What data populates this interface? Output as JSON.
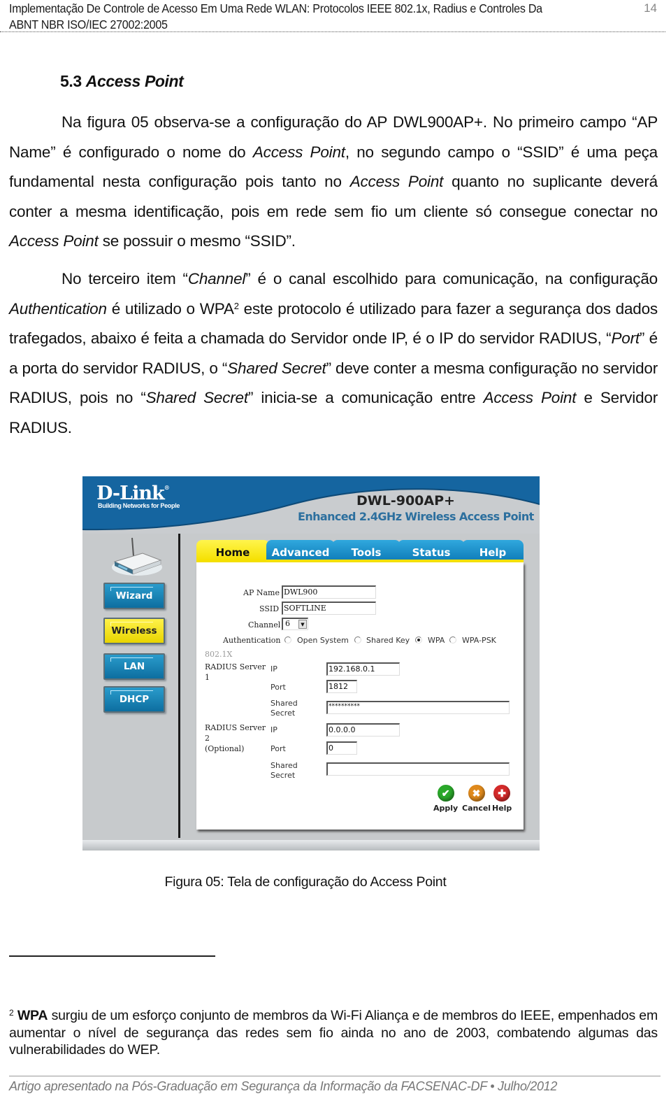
{
  "header": {
    "running_title_line1": "Implementação De Controle de Acesso Em Uma Rede WLAN: Protocolos IEEE 802.1x, Radius e Controles Da",
    "running_title_line2": "ABNT NBR ISO/IEC 27002:2005",
    "page_number": "14"
  },
  "section": {
    "number": "5.3",
    "title": "Access Point"
  },
  "paragraphs": {
    "p1": {
      "s1": "Na figura 05 observa-se a configuração do AP DWL900AP+. No primeiro campo “AP Name” é configurado o nome do ",
      "i1": "Access Point",
      "s2": ", no segundo campo o “SSID” é uma peça fundamental nesta configuração pois tanto no ",
      "i2": "Access Point",
      "s3": " quanto no suplicante deverá conter a mesma identificação, pois em rede sem fio um cliente só consegue conectar no ",
      "i3": "Access Point",
      "s4": " se possuir o mesmo “SSID”."
    },
    "p2": {
      "s1": "No terceiro item “",
      "i1": "Channel",
      "s2": "” é o canal escolhido para comunicação, na configuração ",
      "i2": "Authentication",
      "s3": " é utilizado o WPA",
      "sup": "2",
      "s4": " este protocolo é utilizado para fazer a segurança dos dados trafegados, abaixo é feita a chamada do Servidor onde IP, é o IP do servidor RADIUS, “",
      "i3": "Port",
      "s5": "” é a porta do servidor RADIUS, o “",
      "i4": "Shared Secret",
      "s6": "” deve conter a mesma configuração no servidor RADIUS, pois no “",
      "i5": "Shared Secret",
      "s7": "” inicia-se a comunicação entre ",
      "i6": "Access Point",
      "s8": " e Servidor RADIUS."
    }
  },
  "figure": {
    "brand": "D-Link",
    "brand_mark": "®",
    "tagline": "Building Networks for People",
    "model": "DWL-900AP+",
    "subtitle": "Enhanced 2.4GHz Wireless Access Point",
    "colors": {
      "brand_blue": "#1565a0",
      "tab_blue": "#1a8cc8",
      "tab_active_yellow": "#f5e000",
      "panel_gray": "#c7cacc"
    },
    "tabs": [
      {
        "label": "Home",
        "active": true
      },
      {
        "label": "Advanced",
        "active": false
      },
      {
        "label": "Tools",
        "active": false
      },
      {
        "label": "Status",
        "active": false
      },
      {
        "label": "Help",
        "active": false
      }
    ],
    "sidebar": [
      {
        "label": "Wizard",
        "active": false
      },
      {
        "label": "Wireless",
        "active": true
      },
      {
        "label": "LAN",
        "active": false
      },
      {
        "label": "DHCP",
        "active": false
      }
    ],
    "form": {
      "ap_name_label": "AP Name",
      "ap_name_value": "DWL900",
      "ssid_label": "SSID",
      "ssid_value": "SOFTLINE",
      "channel_label": "Channel",
      "channel_value": "6",
      "auth_label": "Authentication",
      "auth_options": [
        {
          "label": "Open System",
          "selected": false
        },
        {
          "label": "Shared Key",
          "selected": false
        },
        {
          "label": "WPA",
          "selected": true
        },
        {
          "label": "WPA-PSK",
          "selected": false
        }
      ],
      "section_8021x": "802.1X",
      "radius1": {
        "title_line1": "RADIUS Server",
        "title_line2": "1",
        "ip_label": "IP",
        "ip_value": "192.168.0.1",
        "port_label": "Port",
        "port_value": "1812",
        "secret_label_line1": "Shared",
        "secret_label_line2": "Secret",
        "secret_value": "**********"
      },
      "radius2": {
        "title_line1": "RADIUS Server",
        "title_line2": "2",
        "title_line3": "(Optional)",
        "ip_label": "IP",
        "ip_value": "0.0.0.0",
        "port_label": "Port",
        "port_value": "0",
        "secret_label_line1": "Shared",
        "secret_label_line2": "Secret",
        "secret_value": ""
      }
    },
    "actions": [
      {
        "label": "Apply",
        "icon": "check-icon",
        "glyph": "✔",
        "color": "#2aa82a"
      },
      {
        "label": "Cancel",
        "icon": "x-icon",
        "glyph": "✖",
        "color": "#e08a1c"
      },
      {
        "label": "Help",
        "icon": "plus-icon",
        "glyph": "✚",
        "color": "#d42a2a"
      }
    ]
  },
  "caption": "Figura 05: Tela de configuração do Access Point",
  "footnote": {
    "marker": "2",
    "term": "WPA",
    "text": " surgiu de um esforço conjunto de membros da Wi-Fi Aliança e de membros do IEEE, empenhados em aumentar o nível de segurança das redes sem fio ainda no ano de 2003, combatendo algumas das vulnerabilidades do WEP."
  },
  "footer": "Artigo apresentado na Pós-Graduação em Segurança da Informação da FACSENAC-DF • Julho/2012"
}
